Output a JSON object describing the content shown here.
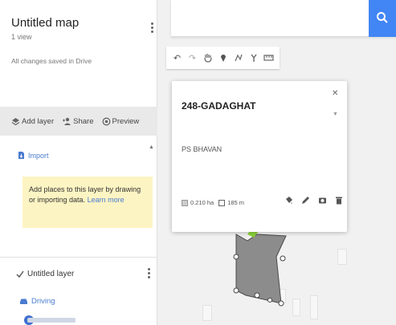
{
  "panel": {
    "title": "Untitled map",
    "views": "1 view",
    "saved_status": "All changes saved in Drive",
    "actions": {
      "add_layer": "Add layer",
      "share": "Share",
      "preview": "Preview"
    },
    "import_label": "Import",
    "hint_text": "Add places to this layer by drawing or importing data.",
    "hint_link": "Learn more",
    "layer_name": "Untitled layer",
    "driving_label": "Driving"
  },
  "toolbar": {
    "tools": [
      "undo-icon",
      "redo-icon",
      "hand-icon",
      "marker-icon",
      "draw-line-icon",
      "directions-icon",
      "ruler-icon"
    ]
  },
  "card": {
    "title": "248-GADAGHAT",
    "description": "PS BHAVAN",
    "area": "0.210 ha",
    "perimeter": "185 m"
  },
  "colors": {
    "accent_blue": "#4285f4",
    "hint_bg": "#fdf4c3",
    "polygon_fill": "#8c8c8c",
    "highlight_green": "#8bd33a"
  }
}
